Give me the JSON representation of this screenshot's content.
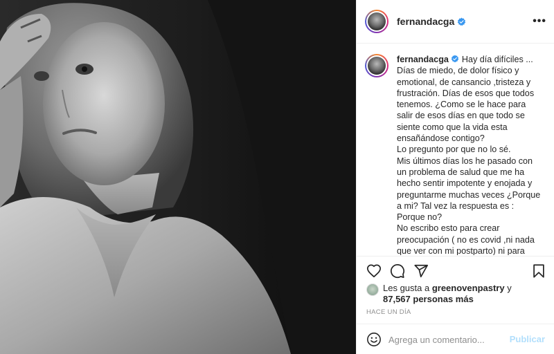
{
  "post": {
    "username": "fernandacga",
    "more_label": "•••",
    "caption": {
      "lines": [
        "Hay día difíciles ...",
        "Días de miedo, de dolor físico y emotional, de cansancio ,tristeza y frustración. Días de esos que todos tenemos. ¿Como se le hace para salir de esos días en que todo se siente como que la vida esta ensañándose contigo?",
        "Lo pregunto por que no lo sé.",
        "Mis últimos días los he pasado con un problema de salud que me ha hecho sentir impotente y enojada y preguntarme muchas veces ¿Porque a mi? Tal vez la respuesta es : Porque no?",
        "No escribo esto para crear preocupación ( no es covid ,ni nada que ver con mi postparto) ni para recibir aliento (aunque siempre"
      ]
    },
    "likes": {
      "prefix": "Les gusta a ",
      "first_user": "greenovenpastry",
      "joiner": " y",
      "count_text": "87,567 personas más"
    },
    "timestamp": "HACE UN DÍA",
    "comment": {
      "placeholder": "Agrega un comentario...",
      "submit_label": "Publicar"
    }
  },
  "icons": {
    "verified": "verified-badge-icon",
    "like": "heart-icon",
    "comment": "comment-icon",
    "share": "share-icon",
    "save": "bookmark-icon",
    "emoji": "emoji-icon"
  },
  "colors": {
    "verified_blue": "#3897f0",
    "publish_disabled": "#b2dffc",
    "text_primary": "#262626",
    "text_secondary": "#8e8e8e",
    "divider": "#efefef"
  }
}
